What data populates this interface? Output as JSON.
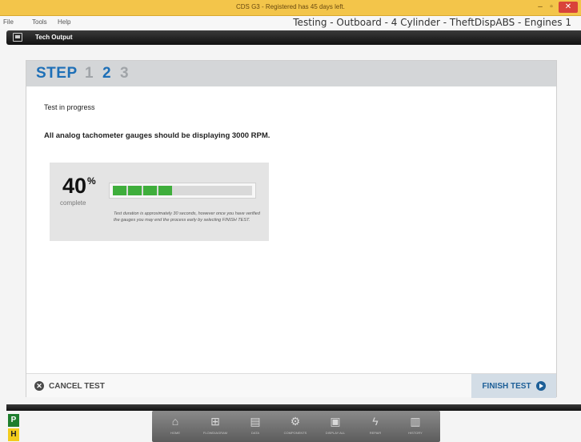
{
  "window": {
    "title": "CDS G3 - Registered has 45 days left.",
    "minimize": "–",
    "maximize": "▫",
    "close": "✕"
  },
  "menu": {
    "items": [
      "File",
      "Tools",
      "Help"
    ],
    "caption": "Testing - Outboard - 4 Cylinder - TheftDispABS - Engines 1"
  },
  "tab": {
    "label": "Tech Output",
    "icon": "monitor-icon"
  },
  "steps": {
    "label": "STEP",
    "numbers": [
      "1",
      "2",
      "3"
    ],
    "current": 2
  },
  "main": {
    "status": "Test in progress",
    "instruction": "All analog tachometer gauges should be displaying 3000 RPM."
  },
  "progress": {
    "percent_value": "40",
    "percent_sign": "%",
    "caption": "complete",
    "fraction": 0.4,
    "filled_segments": 4,
    "note": "Test duration is approximately 30 seconds, however once you have verified the gauges you may end the process early by selecting FINISH TEST."
  },
  "actions": {
    "cancel_label": "CANCEL TEST",
    "finish_label": "FINISH TEST"
  },
  "badges": {
    "p": "P",
    "h": "H"
  },
  "dock": {
    "items": [
      {
        "label": "HOME",
        "icon": "home-icon"
      },
      {
        "label": "FLOWDIAGRAM",
        "icon": "flow-diagram-icon"
      },
      {
        "label": "DATA",
        "icon": "data-icon"
      },
      {
        "label": "COMPONENTS",
        "icon": "components-icon"
      },
      {
        "label": "DISPLAY ALL",
        "icon": "display-icon"
      },
      {
        "label": "REPAIR",
        "icon": "lightning-icon"
      },
      {
        "label": "HISTORY",
        "icon": "history-icon"
      }
    ]
  },
  "colors": {
    "titlebar": "#f3c54a",
    "accent_blue": "#1d6fb7",
    "progress_green": "#3fae3c",
    "close_red": "#d9433a",
    "badge_green": "#1e7e2e",
    "badge_yellow": "#f2cc1d"
  }
}
